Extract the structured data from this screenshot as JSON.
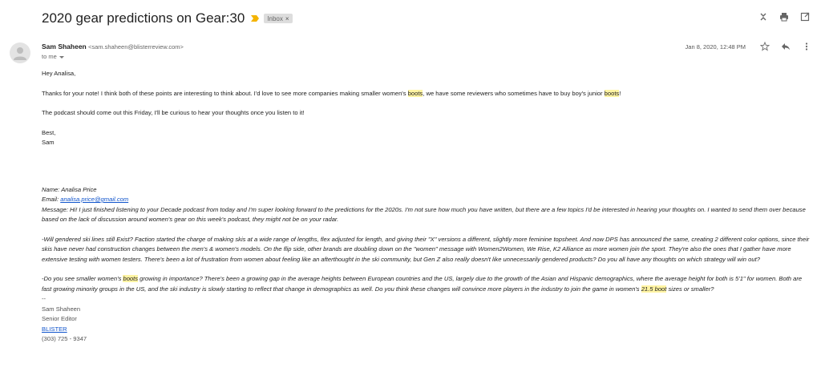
{
  "subject": "2020 gear predictions on Gear:30",
  "label_chip": "Inbox",
  "label_chip_close": "×",
  "colors": {
    "importance": "#f4b400",
    "link": "#1155cc",
    "highlight": "#fff4a3"
  },
  "icons": {
    "top": [
      "expand-collapse-icon",
      "print-icon",
      "open-in-new-window-icon"
    ],
    "message": [
      "star-icon",
      "reply-icon",
      "more-vert-icon"
    ]
  },
  "sender": {
    "name": "Sam Shaheen",
    "email": "<sam.shaheen@blisterreview.com>",
    "to": "to me",
    "date": "Jan 8, 2020, 12:48 PM"
  },
  "body": {
    "greeting": "Hey Analisa,",
    "p1_a": "Thanks for your note! I think both of these points are interesting to think about. I'd love to see more companies making smaller women's ",
    "p1_hl1": "boots",
    "p1_b": ", we have some reviewers who sometimes have to buy boy's junior ",
    "p1_hl2": "boots",
    "p1_c": "!",
    "p2": "The podcast should come out this Friday, I'll be curious to hear your thoughts once you listen to it!",
    "closing": "Best,",
    "sign": "Sam"
  },
  "quoted": {
    "name": "Name: Analisa Price",
    "email_label": "Email: ",
    "email_link": "analisa.price@gmail.com",
    "message": "Message: Hi! I just finished listening to your Decade podcast from today and I'm super looking forward to the predictions for the 2020s. I'm not sure how much you have written, but there are a few topics I'd be interested in hearing your thoughts on. I wanted to send them over because based on the lack of discussion around women's gear on this week's podcast, they might not be on your radar.",
    "para2": "-Will gendered ski lines still Exist? Faction started the charge of making skis at a wide range of lengths, flex adjusted for length, and giving their \"X\" versions a different, slightly more feminine topsheet. And now DPS has announced the same, creating 2 different color options, since their skis have never had construction changes between the men's & women's models. On the flip side, other brands are doubling down on the \"women\" message with Women2Women, We Rise, K2 Alliance as more women join the sport. They're also the ones that I gather have more extensive testing with women testers. There's been a lot of frustration from women about feeling like an afterthought in the ski community, but Gen Z also really doesn't like unnecessarily gendered products? Do you all have any thoughts on which strategy will win out?",
    "para3_a": "-Do you see smaller women's ",
    "para3_hl1": "boots",
    "para3_b": " growing in importance? There's been a growing gap in the average heights between European countries and the US, largely due to the growth of the Asian and Hispanic demographics, where the average height for both is 5'1\" for women. Both are fast growing minority groups in the US, and the ski industry is slowly starting to reflect that change in demographics as well. Do you think these changes will convince more players in the industry to join the game in women's ",
    "para3_hl2": "21.5 boot",
    "para3_c": " sizes or smaller?"
  },
  "signature": {
    "dashes": "--",
    "name": "Sam Shaheen",
    "title": "Senior Editor",
    "company_link": "BLISTER",
    "phone": "(303) 725 - 9347"
  }
}
